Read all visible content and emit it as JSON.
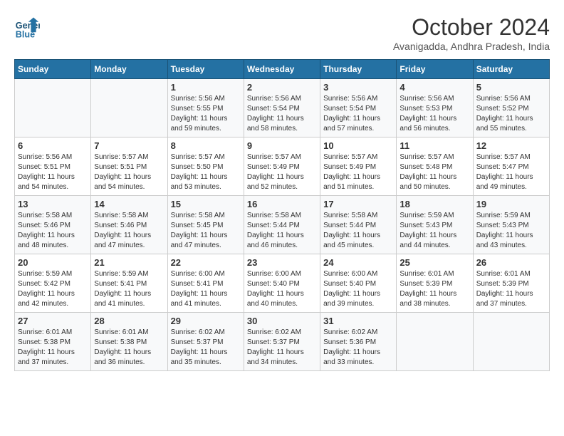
{
  "header": {
    "logo_line1": "General",
    "logo_line2": "Blue",
    "month": "October 2024",
    "location": "Avanigadda, Andhra Pradesh, India"
  },
  "days_of_week": [
    "Sunday",
    "Monday",
    "Tuesday",
    "Wednesday",
    "Thursday",
    "Friday",
    "Saturday"
  ],
  "weeks": [
    [
      {
        "num": "",
        "info": ""
      },
      {
        "num": "",
        "info": ""
      },
      {
        "num": "1",
        "info": "Sunrise: 5:56 AM\nSunset: 5:55 PM\nDaylight: 11 hours and 59 minutes."
      },
      {
        "num": "2",
        "info": "Sunrise: 5:56 AM\nSunset: 5:54 PM\nDaylight: 11 hours and 58 minutes."
      },
      {
        "num": "3",
        "info": "Sunrise: 5:56 AM\nSunset: 5:54 PM\nDaylight: 11 hours and 57 minutes."
      },
      {
        "num": "4",
        "info": "Sunrise: 5:56 AM\nSunset: 5:53 PM\nDaylight: 11 hours and 56 minutes."
      },
      {
        "num": "5",
        "info": "Sunrise: 5:56 AM\nSunset: 5:52 PM\nDaylight: 11 hours and 55 minutes."
      }
    ],
    [
      {
        "num": "6",
        "info": "Sunrise: 5:56 AM\nSunset: 5:51 PM\nDaylight: 11 hours and 54 minutes."
      },
      {
        "num": "7",
        "info": "Sunrise: 5:57 AM\nSunset: 5:51 PM\nDaylight: 11 hours and 54 minutes."
      },
      {
        "num": "8",
        "info": "Sunrise: 5:57 AM\nSunset: 5:50 PM\nDaylight: 11 hours and 53 minutes."
      },
      {
        "num": "9",
        "info": "Sunrise: 5:57 AM\nSunset: 5:49 PM\nDaylight: 11 hours and 52 minutes."
      },
      {
        "num": "10",
        "info": "Sunrise: 5:57 AM\nSunset: 5:49 PM\nDaylight: 11 hours and 51 minutes."
      },
      {
        "num": "11",
        "info": "Sunrise: 5:57 AM\nSunset: 5:48 PM\nDaylight: 11 hours and 50 minutes."
      },
      {
        "num": "12",
        "info": "Sunrise: 5:57 AM\nSunset: 5:47 PM\nDaylight: 11 hours and 49 minutes."
      }
    ],
    [
      {
        "num": "13",
        "info": "Sunrise: 5:58 AM\nSunset: 5:46 PM\nDaylight: 11 hours and 48 minutes."
      },
      {
        "num": "14",
        "info": "Sunrise: 5:58 AM\nSunset: 5:46 PM\nDaylight: 11 hours and 47 minutes."
      },
      {
        "num": "15",
        "info": "Sunrise: 5:58 AM\nSunset: 5:45 PM\nDaylight: 11 hours and 47 minutes."
      },
      {
        "num": "16",
        "info": "Sunrise: 5:58 AM\nSunset: 5:44 PM\nDaylight: 11 hours and 46 minutes."
      },
      {
        "num": "17",
        "info": "Sunrise: 5:58 AM\nSunset: 5:44 PM\nDaylight: 11 hours and 45 minutes."
      },
      {
        "num": "18",
        "info": "Sunrise: 5:59 AM\nSunset: 5:43 PM\nDaylight: 11 hours and 44 minutes."
      },
      {
        "num": "19",
        "info": "Sunrise: 5:59 AM\nSunset: 5:43 PM\nDaylight: 11 hours and 43 minutes."
      }
    ],
    [
      {
        "num": "20",
        "info": "Sunrise: 5:59 AM\nSunset: 5:42 PM\nDaylight: 11 hours and 42 minutes."
      },
      {
        "num": "21",
        "info": "Sunrise: 5:59 AM\nSunset: 5:41 PM\nDaylight: 11 hours and 41 minutes."
      },
      {
        "num": "22",
        "info": "Sunrise: 6:00 AM\nSunset: 5:41 PM\nDaylight: 11 hours and 41 minutes."
      },
      {
        "num": "23",
        "info": "Sunrise: 6:00 AM\nSunset: 5:40 PM\nDaylight: 11 hours and 40 minutes."
      },
      {
        "num": "24",
        "info": "Sunrise: 6:00 AM\nSunset: 5:40 PM\nDaylight: 11 hours and 39 minutes."
      },
      {
        "num": "25",
        "info": "Sunrise: 6:01 AM\nSunset: 5:39 PM\nDaylight: 11 hours and 38 minutes."
      },
      {
        "num": "26",
        "info": "Sunrise: 6:01 AM\nSunset: 5:39 PM\nDaylight: 11 hours and 37 minutes."
      }
    ],
    [
      {
        "num": "27",
        "info": "Sunrise: 6:01 AM\nSunset: 5:38 PM\nDaylight: 11 hours and 37 minutes."
      },
      {
        "num": "28",
        "info": "Sunrise: 6:01 AM\nSunset: 5:38 PM\nDaylight: 11 hours and 36 minutes."
      },
      {
        "num": "29",
        "info": "Sunrise: 6:02 AM\nSunset: 5:37 PM\nDaylight: 11 hours and 35 minutes."
      },
      {
        "num": "30",
        "info": "Sunrise: 6:02 AM\nSunset: 5:37 PM\nDaylight: 11 hours and 34 minutes."
      },
      {
        "num": "31",
        "info": "Sunrise: 6:02 AM\nSunset: 5:36 PM\nDaylight: 11 hours and 33 minutes."
      },
      {
        "num": "",
        "info": ""
      },
      {
        "num": "",
        "info": ""
      }
    ]
  ]
}
